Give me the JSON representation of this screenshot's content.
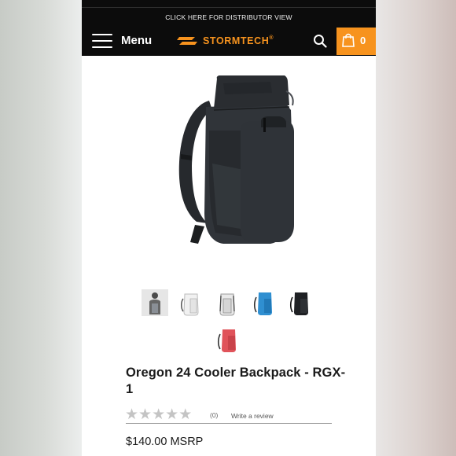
{
  "header": {
    "distributor_link": "CLICK HERE FOR DISTRIBUTOR VIEW",
    "menu_label": "Menu",
    "brand": "STORMTECH",
    "brand_mark": "®",
    "cart_count": "0",
    "accent_color": "#f7931e"
  },
  "product": {
    "title": "Oregon 24 Cooler Backpack - RGX-1",
    "rating_stars": [
      "★",
      "★",
      "★",
      "★",
      "★"
    ],
    "rating_value": 0,
    "review_count": "(0)",
    "write_review": "Write a review",
    "price": "$140.00 MSRP",
    "thumbnail_colors": [
      "model-photo",
      "white",
      "white-grey",
      "blue",
      "black",
      "red"
    ]
  }
}
